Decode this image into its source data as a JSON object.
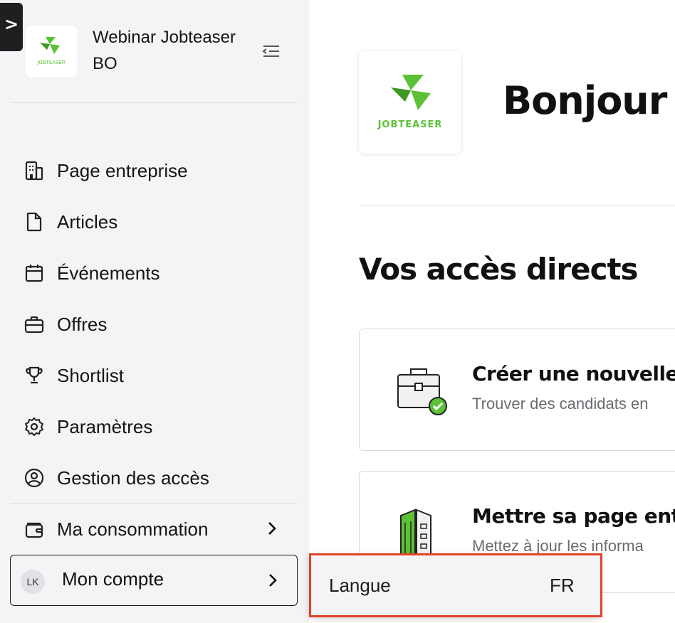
{
  "dev_tab": {
    "glyph": ">"
  },
  "org": {
    "name": "Webinar Jobteaser BO",
    "logo_text": "JOBTEASER",
    "brand_color": "#5cc136"
  },
  "sidebar": {
    "items": [
      {
        "label": "Page entreprise",
        "icon": "building-icon"
      },
      {
        "label": "Articles",
        "icon": "document-icon"
      },
      {
        "label": "Événements",
        "icon": "calendar-icon"
      },
      {
        "label": "Offres",
        "icon": "briefcase-icon"
      },
      {
        "label": "Shortlist",
        "icon": "trophy-icon"
      },
      {
        "label": "Paramètres",
        "icon": "gear-icon"
      },
      {
        "label": "Gestion des accès",
        "icon": "user-circle-icon"
      },
      {
        "label": "Ma consommation",
        "icon": "wallet-icon"
      }
    ],
    "account": {
      "initials": "LK",
      "label": "Mon compte"
    }
  },
  "main": {
    "greeting": "Bonjour",
    "section_title": "Vos accès directs",
    "cards": [
      {
        "title": "Créer une nouvelle",
        "desc": "Trouver des candidats en",
        "icon": "briefcase-check-icon"
      },
      {
        "title": "Mettre sa page ent",
        "desc": "Mettez à jour les informa",
        "icon": "buildings-icon"
      }
    ]
  },
  "popup": {
    "language_label": "Langue",
    "language_value": "FR",
    "highlight_color": "#e0432a"
  }
}
